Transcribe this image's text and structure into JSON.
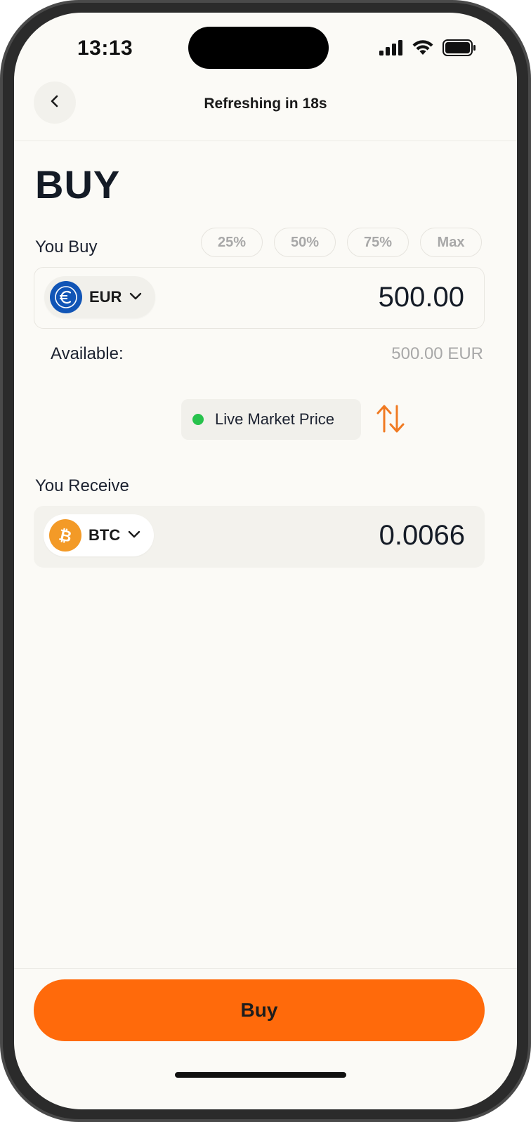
{
  "status_bar": {
    "time": "13:13",
    "icons": [
      "signal-icon",
      "wifi-icon",
      "battery-icon"
    ]
  },
  "header": {
    "back_icon": "chevron-left-icon",
    "refresh_label": "Refreshing in",
    "refresh_countdown": "18s"
  },
  "page": {
    "title": "BUY"
  },
  "you_buy": {
    "label": "You Buy",
    "percent_buttons": [
      "25%",
      "50%",
      "75%",
      "Max"
    ],
    "currency": {
      "code": "EUR",
      "icon": "euro-coin-icon",
      "color": "#1155b6"
    },
    "amount": "500.00",
    "available_label": "Available:",
    "available_value": "500.00 EUR"
  },
  "market": {
    "status_color": "#27c24c",
    "label": "Live Market Price",
    "swap_icon": "swap-arrows-icon",
    "swap_color": "#f07a22"
  },
  "you_receive": {
    "label": "You Receive",
    "currency": {
      "code": "BTC",
      "icon": "bitcoin-coin-icon",
      "color": "#f39a27"
    },
    "amount": "0.0066"
  },
  "footer": {
    "buy_label": "Buy",
    "accent_color": "#ff6a0b"
  }
}
